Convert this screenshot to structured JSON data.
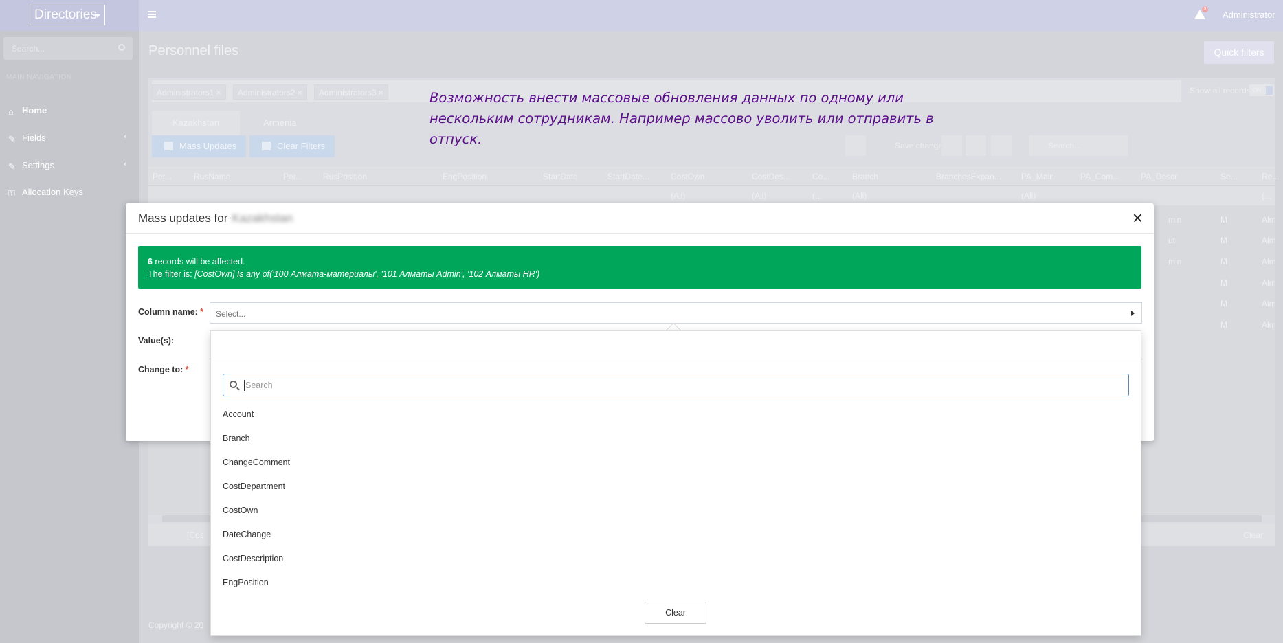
{
  "topbar": {
    "brand": "Directories",
    "user": "Administrator",
    "alert_count": "3"
  },
  "sidebar": {
    "search_placeholder": "Search...",
    "nav_header": "MAIN NAVIGATION",
    "items": [
      {
        "label": "Home",
        "icon": "home-icon"
      },
      {
        "label": "Fields",
        "icon": "wrench-icon"
      },
      {
        "label": "Settings",
        "icon": "wrench-icon"
      },
      {
        "label": "Allocation Keys",
        "icon": "key-icon"
      }
    ]
  },
  "page": {
    "title": "Personnel files",
    "quick_filters": "Quick filters",
    "copyright": "Copyright © 20"
  },
  "filters": {
    "chips": [
      "Administrators1",
      "Administrators2",
      "Administrators3"
    ],
    "show_all": "Show all records",
    "toggle": "ON"
  },
  "tabs": [
    "Kazakhstan",
    "Armenia"
  ],
  "toolbar": {
    "mass_updates": "Mass Updates",
    "clear_filters": "Clear Filters",
    "save_changes": "Save changes",
    "search": "Search..."
  },
  "grid": {
    "columns": [
      "Per...",
      "RusName",
      "Per...",
      "RusPosition",
      "EngPosition",
      "StartDate",
      "StartDate...",
      "CostOwn",
      "CostDes...",
      "Co...",
      "Branch",
      "BranchesExpan...",
      "PA_Main",
      "PA_Com...",
      "PA_Descr",
      "Se...",
      "Re..."
    ],
    "filter_cells": [
      "(All)",
      "(All)",
      "(...",
      "(All)",
      "(All)",
      "(..."
    ],
    "rows": [
      {
        "a": "min",
        "b": "M",
        "c": "Alm"
      },
      {
        "a": "ut",
        "b": "M",
        "c": "Alm"
      },
      {
        "a": "min",
        "b": "M",
        "c": "Alm"
      },
      {
        "a": "",
        "b": "M",
        "c": "Alm"
      },
      {
        "a": "",
        "b": "M",
        "c": "Alm"
      },
      {
        "a": "",
        "b": "M",
        "c": "Alm"
      }
    ],
    "footer_filter": "[Cos",
    "footer_clear": "Clear"
  },
  "annotation": "Возможность внести массовые обновления данных по одному или нескольким сотрудникам. Например массово уволить или отправить в отпуск.",
  "modal": {
    "title": "Mass updates for",
    "title_blurred": "Kazakhstan",
    "count": "6",
    "affected_text": " records will be affected.",
    "filter_label": "The filter is:",
    "filter_text": " [CostOwn] Is any of('100 Алмата-материалы', '101 Алматы Admin', '102 Алматы HR')",
    "column_label": "Column name:",
    "values_label": "Value(s):",
    "change_label": "Change to:",
    "required_mark": "*",
    "select_placeholder": "Select..."
  },
  "dropdown": {
    "search_placeholder": "Search",
    "items": [
      "Account",
      "Branch",
      "ChangeComment",
      "CostDepartment",
      "CostOwn",
      "DateChange",
      "CostDescription",
      "EngPosition"
    ],
    "clear": "Clear"
  },
  "colors": {
    "success": "#00a65a",
    "annotation": "#5b0e8a",
    "topbar": "#cfd1e6"
  }
}
